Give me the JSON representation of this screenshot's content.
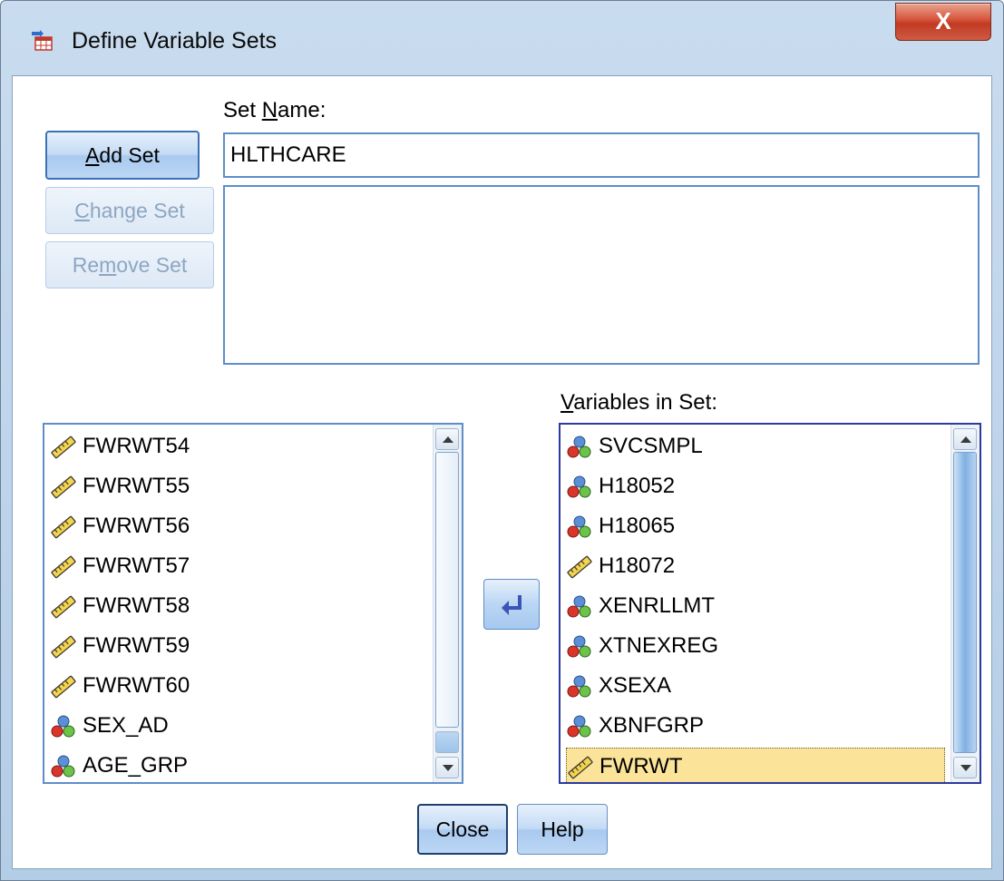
{
  "window": {
    "title": "Define Variable Sets",
    "close_glyph": "X"
  },
  "set_name": {
    "label_pre": "Set ",
    "label_accel": "N",
    "label_post": "ame:",
    "value": "HLTHCARE"
  },
  "buttons": {
    "add_set_accel": "A",
    "add_set_rest": "dd Set",
    "change_set_accel": "C",
    "change_set_rest": "hange Set",
    "remove_set_pre": "Re",
    "remove_set_accel": "m",
    "remove_set_post": "ove Set",
    "close": "Close",
    "help": "Help"
  },
  "variables_in_set": {
    "label_accel": "V",
    "label_rest": "ariables in Set:",
    "items": [
      {
        "name": "SVCSMPL",
        "icon": "nominal-icon"
      },
      {
        "name": "H18052",
        "icon": "nominal-icon"
      },
      {
        "name": "H18065",
        "icon": "nominal-icon"
      },
      {
        "name": "H18072",
        "icon": "scale-icon"
      },
      {
        "name": "XENRLLMT",
        "icon": "nominal-icon"
      },
      {
        "name": "XTNEXREG",
        "icon": "nominal-icon"
      },
      {
        "name": "XSEXA",
        "icon": "nominal-icon"
      },
      {
        "name": "XBNFGRP",
        "icon": "nominal-icon"
      },
      {
        "name": "FWRWT",
        "icon": "scale-icon",
        "selected": true
      }
    ]
  },
  "source_variables": {
    "items": [
      {
        "name": "FWRWT54",
        "icon": "scale-icon"
      },
      {
        "name": "FWRWT55",
        "icon": "scale-icon"
      },
      {
        "name": "FWRWT56",
        "icon": "scale-icon"
      },
      {
        "name": "FWRWT57",
        "icon": "scale-icon"
      },
      {
        "name": "FWRWT58",
        "icon": "scale-icon"
      },
      {
        "name": "FWRWT59",
        "icon": "scale-icon"
      },
      {
        "name": "FWRWT60",
        "icon": "scale-icon"
      },
      {
        "name": "SEX_AD",
        "icon": "nominal-icon"
      },
      {
        "name": "AGE_GRP",
        "icon": "nominal-icon"
      }
    ]
  },
  "colors": {
    "selection": "#fbe49a",
    "field_border": "#5f8dc9",
    "close_button": "#c13a22"
  }
}
